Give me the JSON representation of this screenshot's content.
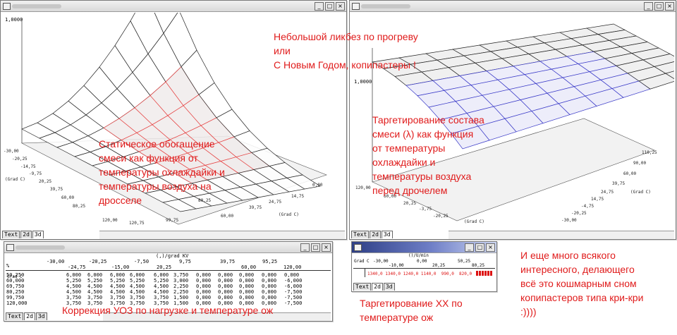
{
  "window_controls": {
    "minimize": "_",
    "maximize": "□",
    "close": "×"
  },
  "tab_labels": [
    "Text",
    "2d",
    "3d"
  ],
  "left_window": {
    "z_label": "1,0000",
    "x_ticks": [
      "-30,00",
      "-20,25",
      "-14,75",
      "-9,75",
      "20,25",
      "39,75",
      "60,00",
      "80,25",
      "120,00"
    ],
    "y_ticks": [
      "0,00",
      "14,75",
      "24,75",
      "39,75",
      "60,00",
      "80,25",
      "99,75",
      "120,75"
    ],
    "axis_label": "(Grad C)",
    "annotation": [
      "Статическое обогащение",
      "смеси как функция от",
      "температуры охлаждайки и",
      "температуры воздуха на",
      "дросселе"
    ]
  },
  "right_window": {
    "z_label": "1,0000",
    "left_ticks": [
      "120,00",
      "60,00",
      "20,25",
      "-3,75",
      "-20,25"
    ],
    "right_ticks": [
      "110,25",
      "90,00",
      "60,00",
      "39,75",
      "24,75",
      "14,75",
      "-4,75",
      "-20,25",
      "-30,00"
    ],
    "axis_label": "(Grad C)",
    "annotation": [
      "Таргетирование состава",
      "смеси (λ) как функция",
      "от температуры",
      "охлаждайки и",
      "температуры воздуха",
      "перед дрочелем"
    ]
  },
  "center_annotation": [
    "Небольшой ликбез по прогреву",
    "или",
    "С Новым Годом, копипастеры !"
  ],
  "uoz_table": {
    "unit": "(,)/grad KV",
    "corner": "%",
    "row_label": "Grad C",
    "headers_top": [
      "-30,00",
      "-20,25",
      "-7,50",
      "9,75",
      "39,75",
      "95,25"
    ],
    "headers_bottom": [
      "-24,75",
      "-15,00",
      "20,25",
      "60,00",
      "120,00"
    ],
    "rows": [
      {
        "label": "50,250",
        "values": [
          "6,000",
          "6,000",
          "6,000",
          "6,000",
          "6,000",
          "3,750",
          "0,000",
          "0,000",
          "0,000",
          "0,000",
          "0,000"
        ]
      },
      {
        "label": "60,000",
        "values": [
          "5,250",
          "5,250",
          "5,250",
          "5,250",
          "5,250",
          "3,000",
          "0,000",
          "0,000",
          "0,000",
          "0,000",
          "-6,000"
        ]
      },
      {
        "label": "69,750",
        "values": [
          "4,500",
          "4,500",
          "4,500",
          "4,500",
          "4,500",
          "2,250",
          "0,000",
          "0,000",
          "0,000",
          "0,000",
          "-6,000"
        ]
      },
      {
        "label": "80,250",
        "values": [
          "4,500",
          "4,500",
          "4,500",
          "4,500",
          "4,500",
          "2,250",
          "0,000",
          "0,000",
          "0,000",
          "0,000",
          "-7,500"
        ]
      },
      {
        "label": "99,750",
        "values": [
          "3,750",
          "3,750",
          "3,750",
          "3,750",
          "3,750",
          "1,500",
          "0,000",
          "0,000",
          "0,000",
          "0,000",
          "-7,500"
        ]
      },
      {
        "label": "120,000",
        "values": [
          "3,750",
          "3,750",
          "3,750",
          "3,750",
          "3,750",
          "1,500",
          "0,000",
          "0,000",
          "0,000",
          "0,000",
          "-7,500"
        ]
      }
    ],
    "annotation": "Коррекция УОЗ по нагрузке и температуре ож"
  },
  "xx_table": {
    "unit": "()/U/min",
    "corner": "Grad C",
    "headers_top": [
      "-30,00",
      "0,00",
      "50,25"
    ],
    "headers_bottom": [
      "-10,00",
      "20,25",
      "80,25"
    ],
    "values": "1340,0 1340,0 1240,0 1140,0  990,0  820,0",
    "annotation": [
      "Таргетирование ХХ  по",
      "температуре ож"
    ]
  },
  "side_annotation": [
    "И еще много всякого",
    "интересного, делающего",
    "всё это кошмарным сном",
    "копипастеров типа кри-кри",
    ":))))"
  ]
}
